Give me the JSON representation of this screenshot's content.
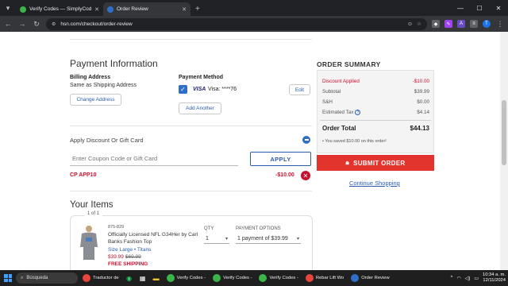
{
  "browser": {
    "tabs": [
      {
        "title": "Verify Codes — SimplyCodes",
        "active": false,
        "color": "#3bb54a"
      },
      {
        "title": "Order Review",
        "active": true,
        "color": "#2f6fc7"
      }
    ],
    "url": "hsn.com/checkout/order-review"
  },
  "payment": {
    "heading": "Payment Information",
    "billing_label": "Billing Address",
    "billing_value": "Same as Shipping Address",
    "change_address": "Change Address",
    "method_label": "Payment Method",
    "card_brand": "VISA",
    "card_text": "Visa: ****76",
    "edit": "Edit",
    "add_another": "Add Another"
  },
  "discount": {
    "label": "Apply Discount Or Gift Card",
    "input_placeholder": "Enter Coupon Code or Gift Card",
    "apply": "APPLY",
    "applied_code": "CP APP10",
    "applied_amount": "-$10.00"
  },
  "items": {
    "heading": "Your Items",
    "page_indicator": "1 of 1",
    "product": {
      "sku": "875-829",
      "name": "Officially Licensed NFL G34Her by Carl Banks Fashion Top",
      "size_color": "Size Large • Titans",
      "price": "$39.99",
      "old_price": "$69.99",
      "shipping": "FREE SHIPPING"
    },
    "qty_label": "QTY",
    "qty_value": "1",
    "payment_options_label": "PAYMENT OPTIONS",
    "payment_options_value": "1 payment of $39.99"
  },
  "summary": {
    "title": "ORDER SUMMARY",
    "rows": [
      {
        "label": "Discount Applied",
        "value": "-$10.00",
        "red": true
      },
      {
        "label": "Subtotal",
        "value": "$39.99"
      },
      {
        "label": "S&H",
        "value": "$0.00"
      },
      {
        "label": "Estimated Tax",
        "value": "$4.14",
        "help": true
      }
    ],
    "total_label": "Order Total",
    "total_value": "$44.13",
    "saved_note": "You saved $10.00 on this order!",
    "submit": "SUBMIT ORDER",
    "continue": "Continue Shopping"
  },
  "taskbar": {
    "search": "Búsqueda",
    "apps": [
      {
        "label": "Traductor de",
        "color": "#e8453c"
      },
      {
        "label": "Verify Codes -",
        "color": "#3bb54a"
      },
      {
        "label": "Verify Codes -",
        "color": "#3bb54a"
      },
      {
        "label": "Verify Codes -",
        "color": "#3bb54a"
      },
      {
        "label": "Rebar Lift Wo",
        "color": "#e8453c"
      },
      {
        "label": "Order Review",
        "color": "#2f6fc7"
      }
    ],
    "time": "10:34 a. m.",
    "date": "12/11/2024"
  },
  "colors": {
    "accent": "#2a5db0",
    "sale_red": "#c8102e",
    "submit_red": "#e2342c"
  }
}
